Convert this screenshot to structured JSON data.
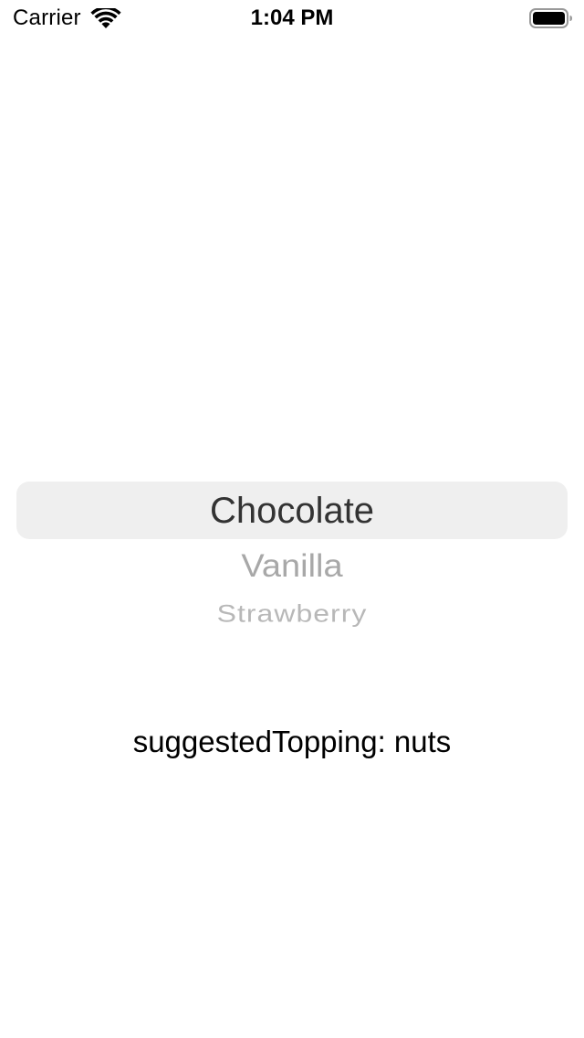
{
  "status_bar": {
    "carrier": "Carrier",
    "time": "1:04 PM"
  },
  "picker": {
    "options": [
      "Chocolate",
      "Vanilla",
      "Strawberry"
    ],
    "selected": "Chocolate"
  },
  "info": {
    "text": "suggestedTopping: nuts"
  }
}
